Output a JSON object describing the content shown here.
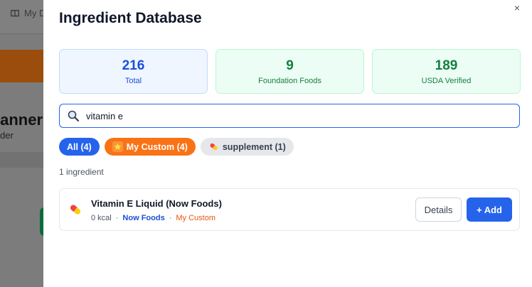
{
  "background": {
    "nav_label": "My D",
    "page_title": "lanner",
    "page_subtitle": "der"
  },
  "modal": {
    "title": "Ingredient Database",
    "close_glyph": "×",
    "stats": [
      {
        "value": "216",
        "label": "Total"
      },
      {
        "value": "9",
        "label": "Foundation Foods"
      },
      {
        "value": "189",
        "label": "USDA Verified"
      }
    ],
    "search": {
      "value": "vitamin e",
      "icon": "search-icon"
    },
    "filters": [
      {
        "label": "All (4)",
        "icon": ""
      },
      {
        "label": "My Custom (4)",
        "icon": "star-icon"
      },
      {
        "label": "supplement (1)",
        "icon": "pill-icon"
      }
    ],
    "result_count": "1 ingredient",
    "results": [
      {
        "name": "Vitamin E Liquid (Now Foods)",
        "kcal": "0 kcal",
        "brand": "Now Foods",
        "tag": "My Custom",
        "icon": "pill-icon",
        "details_label": "Details",
        "add_label": "+ Add"
      }
    ]
  },
  "colors": {
    "accent": "#2563eb",
    "orange": "#f97316",
    "green": "#15803d"
  }
}
